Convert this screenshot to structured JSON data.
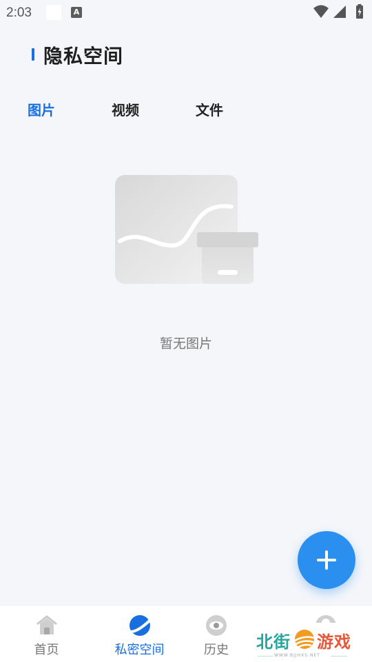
{
  "status_bar": {
    "time": "2:03",
    "app_icon_letter": "A"
  },
  "header": {
    "title": "隐私空间",
    "accent_color": "#1e6fe6"
  },
  "tabs": [
    {
      "label": "图片",
      "active": true
    },
    {
      "label": "视频",
      "active": false
    },
    {
      "label": "文件",
      "active": false
    }
  ],
  "empty_state": {
    "message": "暂无图片",
    "icon": "empty-photo-box-illustration"
  },
  "fab": {
    "icon": "plus-icon",
    "color": "#2b8ff0"
  },
  "bottom_nav": {
    "items": [
      {
        "label": "首页",
        "icon": "home-icon",
        "active": false
      },
      {
        "label": "私密空间",
        "icon": "private-space-icon",
        "active": true
      },
      {
        "label": "历史",
        "icon": "eye-icon",
        "active": false
      },
      {
        "label": "",
        "icon": "profile-icon",
        "active": false
      }
    ]
  },
  "watermark": {
    "left_text": "北街",
    "right_text": "游戏",
    "sub_text": "WWW.BJJHXS.NET"
  }
}
